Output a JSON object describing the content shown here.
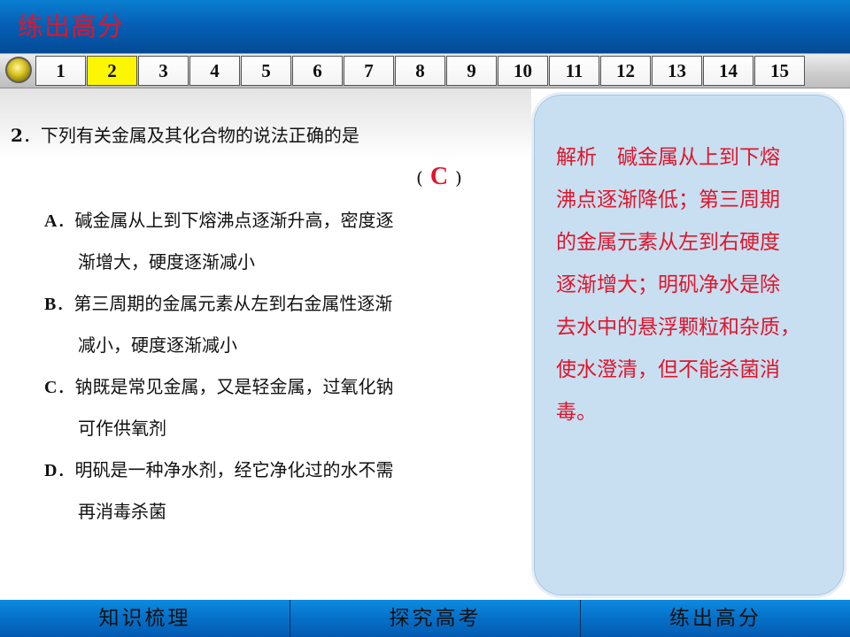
{
  "header": {
    "title": "练出高分",
    "title_color": "#e0152b"
  },
  "nav": {
    "knob_icon": "yellow-orb-icon",
    "numbers": [
      "1",
      "2",
      "3",
      "4",
      "5",
      "6",
      "7",
      "8",
      "9",
      "10",
      "11",
      "12",
      "13",
      "14",
      "15"
    ],
    "active": "2",
    "active_color": "#fcf600"
  },
  "question": {
    "number": "2",
    "separator": "．",
    "stem": "下列有关金属及其化合物的说法正确的是",
    "answer_open": "(",
    "answer": "C",
    "answer_close": ")",
    "answer_color": "#e0152b",
    "options": [
      {
        "label": "A",
        "sep": "．",
        "line1": "碱金属从上到下熔沸点逐渐升高，密度逐",
        "line2": "渐增大，硬度逐渐减小"
      },
      {
        "label": "B",
        "sep": "．",
        "line1": "第三周期的金属元素从左到右金属性逐渐",
        "line2": "减小，硬度逐渐减小"
      },
      {
        "label": "C",
        "sep": "．",
        "line1": "钠既是常见金属，又是轻金属，过氧化钠",
        "line2": "可作供氧剂"
      },
      {
        "label": "D",
        "sep": "．",
        "line1": "明矾是一种净水剂，经它净化过的水不需",
        "line2": "再消毒杀菌"
      }
    ]
  },
  "analysis": {
    "lines": [
      "解析　碱金属从上到下熔",
      "沸点逐渐降低；第三周期",
      "的金属元素从左到右硬度",
      "逐渐增大；明矾净水是除",
      "去水中的悬浮颗粒和杂质，",
      "使水澄清，但不能杀菌消",
      "毒。"
    ],
    "text_color": "#e0152b",
    "panel_color": "#c8dff1"
  },
  "footer": {
    "tabs": [
      "知识梳理",
      "探究高考",
      "练出高分"
    ]
  }
}
